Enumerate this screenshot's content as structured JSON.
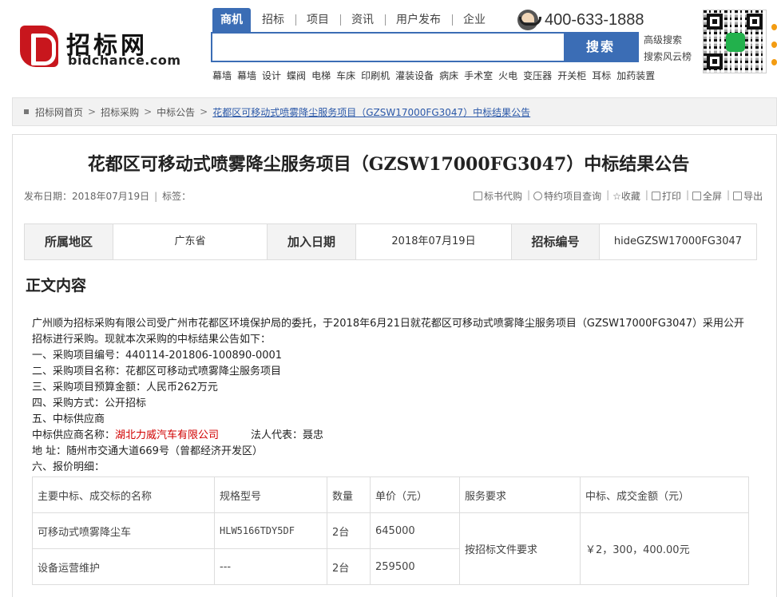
{
  "header": {
    "logo_text": "招标网",
    "logo_domain": "bidchance.com",
    "tabs": [
      "商机",
      "招标",
      "项目",
      "资讯",
      "用户发布",
      "企业"
    ],
    "hotline": "400-633-1888",
    "search_placeholder": "",
    "search_button": "搜索",
    "advanced_search": "高级搜索",
    "search_ranking": "搜索风云榜",
    "hot_words": [
      "幕墙",
      "幕墙",
      "设计",
      "蝶阀",
      "电梯",
      "车床",
      "印刷机",
      "灌装设备",
      "病床",
      "手术室",
      "火电",
      "变压器",
      "开关柜",
      "耳标",
      "加药装置"
    ]
  },
  "breadcrumb": {
    "items": [
      "招标网首页",
      "招标采购",
      "中标公告"
    ],
    "current": "花都区可移动式喷雾降尘服务项目（GZSW17000FG3047）中标结果公告"
  },
  "article": {
    "title": "花都区可移动式喷雾降尘服务项目（GZSW17000FG3047）中标结果公告",
    "publish_label": "发布日期：2018年07月19日",
    "tag_label": "标签：",
    "tools": [
      "标书代购",
      "特约项目查询",
      "收藏",
      "打印",
      "全屏",
      "导出"
    ],
    "info": {
      "region_label": "所属地区",
      "region": "广东省",
      "date_label": "加入日期",
      "date": "2018年07月19日",
      "code_label": "招标编号",
      "code": "hideGZSW17000FG3047"
    },
    "section_title": "正文内容",
    "paragraph_1": "广州顺为招标采购有限公司受广州市花都区环境保护局的委托，于2018年6月21日就花都区可移动式喷雾降尘服务项目（GZSW17000FG3047）采用公开招标进行采购。现就本次采购的中标结果公告如下：",
    "line_1": "一、采购项目编号：440114-201806-100890-0001",
    "line_2": "二、采购项目名称：花都区可移动式喷雾降尘服务项目",
    "line_3": "三、采购项目预算金额：人民币262万元",
    "line_4": "四、采购方式：公开招标",
    "line_5": "五、中标供应商",
    "supplier_label": "中标供应商名称：",
    "supplier_name": "湖北力威汽车有限公司",
    "legal_rep": "法人代表：聂忠",
    "address": "地  址：随州市交通大道669号（曾都经济开发区）",
    "line_6": "六、报价明细：",
    "price_table": {
      "headers": [
        "主要中标、成交标的名称",
        "规格型号",
        "数量",
        "单价（元）",
        "服务要求",
        "中标、成交金额（元）"
      ],
      "rows": [
        [
          "可移动式喷雾降尘车",
          "HLW5166TDY5DF",
          "2台",
          "645000"
        ],
        [
          "设备运营维护",
          "---",
          "2台",
          "259500"
        ]
      ],
      "service_requirement": "按招标文件要求",
      "total_amount": "￥2，300，400.00元"
    }
  }
}
